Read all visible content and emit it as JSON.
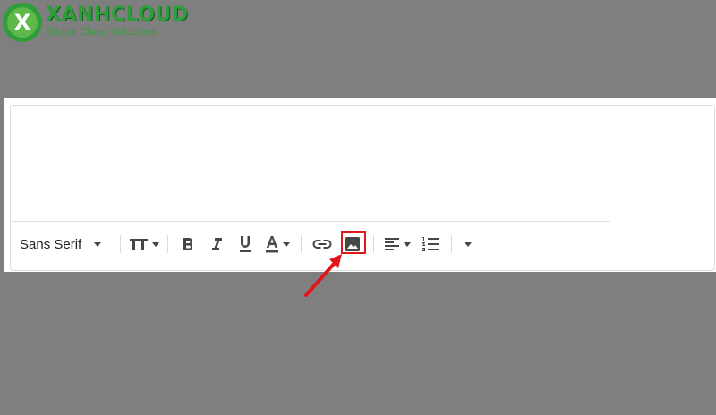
{
  "logo": {
    "name": "XANHCLOUD",
    "tagline": "Global Cloud Solutions",
    "letter": "X"
  },
  "toolbar": {
    "font_name": "Sans Serif",
    "items": [
      {
        "id": "font",
        "icon": "font-dropdown"
      },
      {
        "id": "size",
        "icon": "text-size-icon"
      },
      {
        "id": "bold",
        "icon": "bold-icon",
        "glyph": "B"
      },
      {
        "id": "italic",
        "icon": "italic-icon",
        "glyph": "I"
      },
      {
        "id": "underline",
        "icon": "underline-icon",
        "glyph": "U"
      },
      {
        "id": "color",
        "icon": "text-color-icon",
        "glyph": "A"
      },
      {
        "id": "link",
        "icon": "link-icon"
      },
      {
        "id": "image",
        "icon": "insert-image-icon"
      },
      {
        "id": "align",
        "icon": "align-icon"
      },
      {
        "id": "list",
        "icon": "numbered-list-icon"
      },
      {
        "id": "more",
        "icon": "more-options-icon"
      }
    ]
  },
  "annotation": {
    "highlight_color": "#e0181b"
  },
  "colors": {
    "background": "#807f7f",
    "brand": "#2f9e3a",
    "icon": "#444746"
  }
}
